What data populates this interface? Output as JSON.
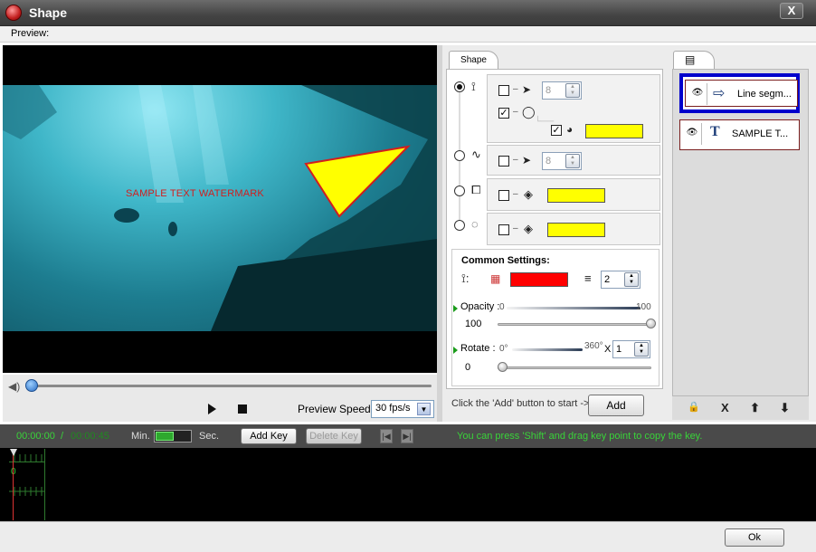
{
  "window": {
    "title": "Shape",
    "close_label": "X"
  },
  "menu": {
    "preview_label": "Preview:"
  },
  "video": {
    "watermark_text": "SAMPLE TEXT WATERMARK",
    "progress": 0.0
  },
  "playback": {
    "speed_label": "Preview Speed:",
    "speed_value": "30 fps/s"
  },
  "shape_panel": {
    "tab_label": "Shape",
    "options": [
      {
        "type": "line",
        "selected": true,
        "arrow_checked": false,
        "arrow_size": "8",
        "circle_checked": true,
        "fill_checked": true,
        "fill_color": "#ffff00"
      },
      {
        "type": "curve",
        "selected": false,
        "arrow_checked": false,
        "arrow_size": "8"
      },
      {
        "type": "rectangle",
        "selected": false,
        "fill_checked": false,
        "fill_color": "#ffff00"
      },
      {
        "type": "ellipse",
        "selected": false,
        "fill_checked": false,
        "fill_color": "#ffff00"
      }
    ],
    "common": {
      "title": "Common Settings:",
      "line_color": "#ff0000",
      "line_width": "2",
      "opacity_label": "Opacity :",
      "opacity_min": "0",
      "opacity_max": "100",
      "opacity_value": "100",
      "rotate_label": "Rotate :",
      "rotate_min": "0°",
      "rotate_max": "360°",
      "rotate_multiplier_symbol": "X",
      "rotate_multiplier": "1",
      "rotate_value": "0"
    },
    "hint": "Click the 'Add' button to start ->",
    "add_label": "Add"
  },
  "layers": {
    "items": [
      {
        "label": "Line segm...",
        "type_icon": "arrow-outline-icon",
        "selected": true
      },
      {
        "label": "SAMPLE T...",
        "type_icon": "text-icon",
        "selected": false
      }
    ],
    "tools": {
      "lock": "🔒",
      "delete": "X",
      "up": "⬆",
      "down": "⬇"
    }
  },
  "timeline": {
    "current_time": "00:00:00",
    "separator": "/",
    "total_time": "00:00:45",
    "min_label": "Min.",
    "sec_label": "Sec.",
    "add_key_label": "Add Key",
    "delete_key_label": "Delete Key",
    "tip": "You can press 'Shift' and drag key point to copy the key.",
    "ruler_zero": "0"
  },
  "footer": {
    "ok_label": "Ok"
  },
  "colors": {
    "accent_blue": "#0000cc",
    "layer_border_dark": "#7a1e1e",
    "timeline_green": "#39d339"
  }
}
